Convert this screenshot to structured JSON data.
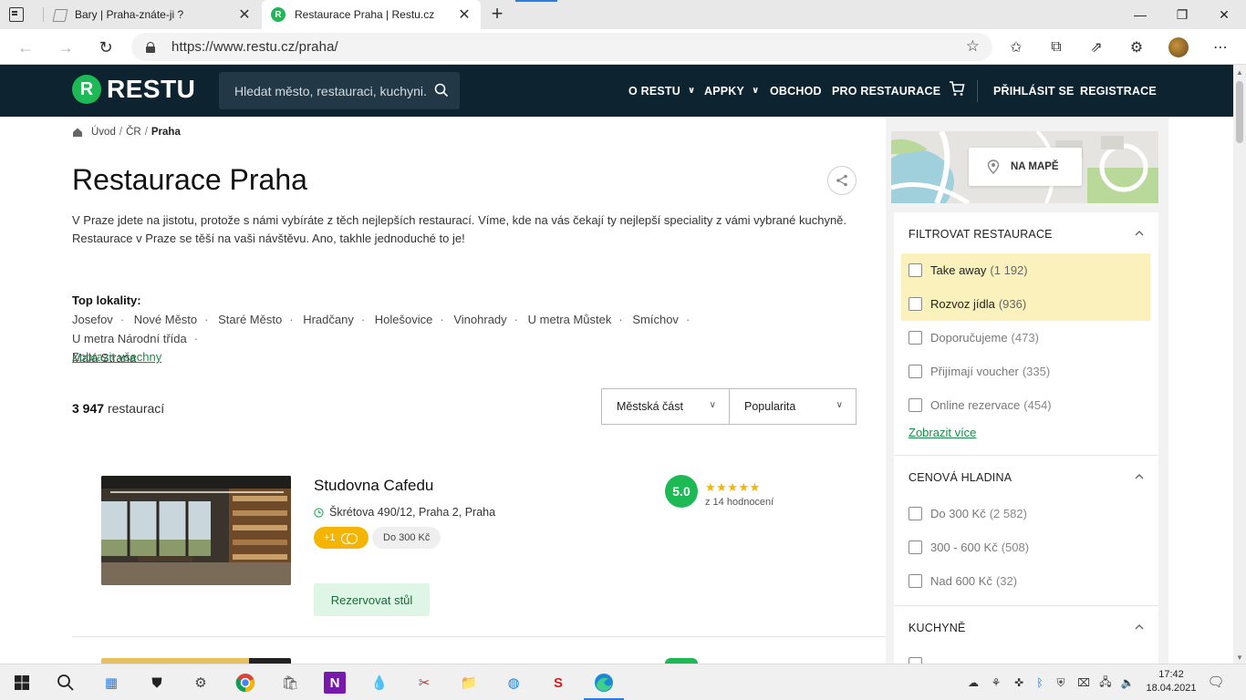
{
  "browser": {
    "tabs": [
      {
        "title": "Bary | Praha-znáte-ji ?",
        "close": "✕"
      },
      {
        "title": "Restaurace Praha | Restu.cz",
        "close": "✕"
      }
    ],
    "new_tab": "+",
    "window_controls": {
      "minimize": "—",
      "maximize": "❐",
      "close": "✕"
    },
    "url": "https://www.restu.cz/praha/"
  },
  "site": {
    "logo_letter": "R",
    "logo_text": "RESTU",
    "search_placeholder": "Hledat město, restauraci, kuchyni...",
    "nav": {
      "o_restu": "O RESTU",
      "appky": "APPKY",
      "obchod": "OBCHOD",
      "pro_restaurace": "PRO RESTAURACE",
      "prihlasit": "PŘIHLÁSIT SE",
      "registrace": "REGISTRACE",
      "caret": "⌄"
    }
  },
  "breadcrumb": {
    "items": [
      "Úvod",
      "ČR",
      "Praha"
    ],
    "separator": "/"
  },
  "page": {
    "title": "Restaurace Praha",
    "intro": "V Praze jdete na jistotu, protože s námi vybíráte z těch nejlepších restaurací. Víme, kde na vás čekají ty nejlepší speciality z vámi vybrané kuchyně. Restaurace v Praze se těší na vaši návštěvu. Ano, takhle jednoduché to je!",
    "top_locations_title": "Top lokality:",
    "locations": [
      "Josefov",
      "Nové Město",
      "Staré Město",
      "Hradčany",
      "Holešovice",
      "Vinohrady",
      "U metra Můstek",
      "Smíchov",
      "U metra Národní třída",
      "Malá Strana"
    ],
    "show_all": "Zobrazit všechny",
    "count_number": "3 947",
    "count_label": "restaurací",
    "select_district": "Městská část",
    "select_sort": "Popularita",
    "select_chevron": "⌄"
  },
  "restaurants": [
    {
      "name": "Studovna Cafedu",
      "address": "Škrétova 490/12, Praha 2, Praha",
      "offer_badge": "+1",
      "price": "Do 300 Kč",
      "rating": "5.0",
      "stars": "★★★★★",
      "reviews": "z 14 hodnocení",
      "reserve_label": "Rezervovat stůl"
    }
  ],
  "sidebar": {
    "map_button": "NA MAPĚ",
    "filter_panel": {
      "title": "FILTROVAT RESTAURACE",
      "items": [
        {
          "label": "Take away",
          "count": "(1 192)",
          "highlighted": true
        },
        {
          "label": "Rozvoz jídla",
          "count": "(936)",
          "highlighted": true
        },
        {
          "label": "Doporučujeme",
          "count": "(473)",
          "highlighted": false
        },
        {
          "label": "Přijímají voucher",
          "count": "(335)",
          "highlighted": false
        },
        {
          "label": "Online rezervace",
          "count": "(454)",
          "highlighted": false
        }
      ],
      "show_more": "Zobrazit více"
    },
    "price_panel": {
      "title": "CENOVÁ HLADINA",
      "items": [
        {
          "label": "Do 300 Kč",
          "count": "(2 582)"
        },
        {
          "label": "300 - 600 Kč",
          "count": "(508)"
        },
        {
          "label": "Nad 600 Kč",
          "count": "(32)"
        }
      ]
    },
    "cuisine_panel": {
      "title": "KUCHYNĚ"
    }
  },
  "taskbar": {
    "time": "17:42",
    "date": "18.04.2021"
  },
  "colors": {
    "brand_green": "#1db954",
    "header_bg": "#0e2330",
    "highlight_yellow": "#fbf1bd",
    "star_yellow": "#f4b400",
    "link_green": "#1a8b4a"
  }
}
